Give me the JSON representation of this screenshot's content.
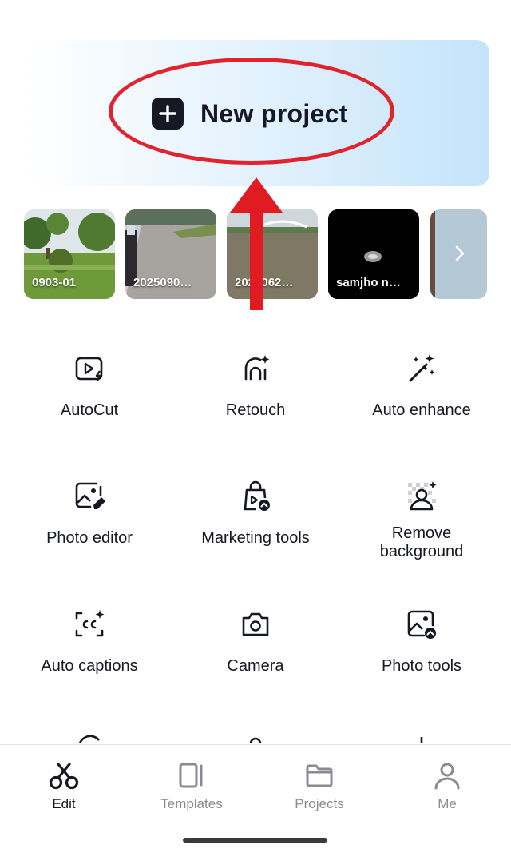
{
  "hero": {
    "label": "New project"
  },
  "recent_projects": [
    {
      "label": "0903-01"
    },
    {
      "label": "2025090…"
    },
    {
      "label": "2025062…"
    },
    {
      "label": "samjho n…"
    }
  ],
  "tools": [
    {
      "label": "AutoCut",
      "icon": "autocut-icon"
    },
    {
      "label": "Retouch",
      "icon": "retouch-icon"
    },
    {
      "label": "Auto enhance",
      "icon": "magic-wand-icon"
    },
    {
      "label": "Photo editor",
      "icon": "photo-edit-icon"
    },
    {
      "label": "Marketing tools",
      "icon": "shopping-bag-icon"
    },
    {
      "label": "Remove\nbackground",
      "icon": "remove-bg-icon"
    },
    {
      "label": "Auto captions",
      "icon": "captions-icon"
    },
    {
      "label": "Camera",
      "icon": "camera-icon"
    },
    {
      "label": "Photo tools",
      "icon": "photo-tools-icon"
    }
  ],
  "tabbar": {
    "edit": "Edit",
    "templates": "Templates",
    "projects": "Projects",
    "me": "Me"
  },
  "colors": {
    "accent_dark": "#161823",
    "annotation_red": "#e0232d",
    "inactive_tab": "#8a8b91"
  }
}
